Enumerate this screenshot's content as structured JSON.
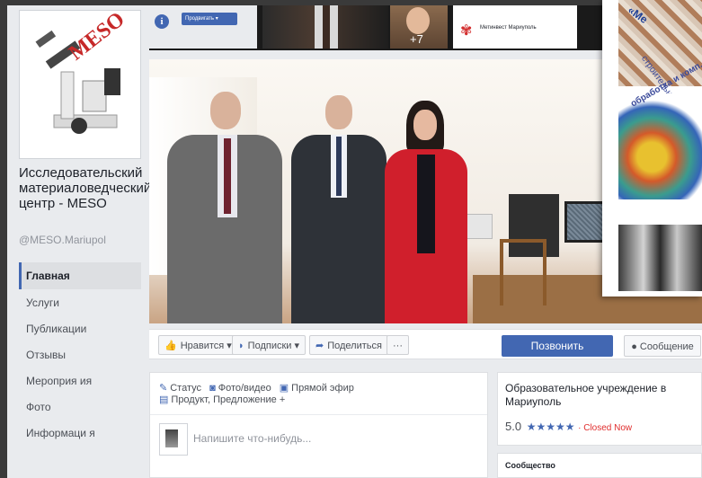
{
  "page": {
    "name": "Исследовательский материаловедческий центр - MESO",
    "handle": "@MESO.Mariupol",
    "logo_text": "MESO"
  },
  "nav": {
    "items": [
      {
        "label": "Главная"
      },
      {
        "label": "Услуги"
      },
      {
        "label": "Публикации"
      },
      {
        "label": "Отзывы"
      },
      {
        "label": "Мероприя ия"
      },
      {
        "label": "Фото"
      },
      {
        "label": "Информаци я"
      }
    ]
  },
  "top_strip": {
    "promote_label": "Продвигать ▾",
    "friends_more": "+7",
    "suggested_page": "Метинвест Мариуполь"
  },
  "action_bar": {
    "like_label": "Нравится ▾",
    "follow_label": "Подписки ▾",
    "share_label": "Поделиться",
    "more_label": "···",
    "call_label": "Позвонить",
    "message_label": "Сообщение"
  },
  "composer": {
    "status_label": "Статус",
    "photo_label": "Фото/видео",
    "live_label": "Прямой эфир",
    "product_label": "Продукт, Предложение +",
    "placeholder": "Напишите что-нибудь..."
  },
  "about": {
    "category": "Образовательное учреждение в Мариуполь",
    "rating": "5.0",
    "stars": "★★★★★",
    "status": "· Closed Now"
  },
  "community": {
    "title": "Сообщество"
  },
  "overlay": {
    "title_text": "«Ме",
    "text1": "строительные материалы",
    "text2": "обработка и комп. моделир."
  },
  "colors": {
    "brand_blue": "#4267b2",
    "page_bg": "#e9ebee",
    "closed_red": "#e02d2d"
  },
  "icons": [
    "info-icon",
    "like-icon",
    "rss-icon",
    "share-icon",
    "message-icon",
    "pencil-icon",
    "camera-icon",
    "video-icon",
    "product-icon",
    "star-icon"
  ]
}
